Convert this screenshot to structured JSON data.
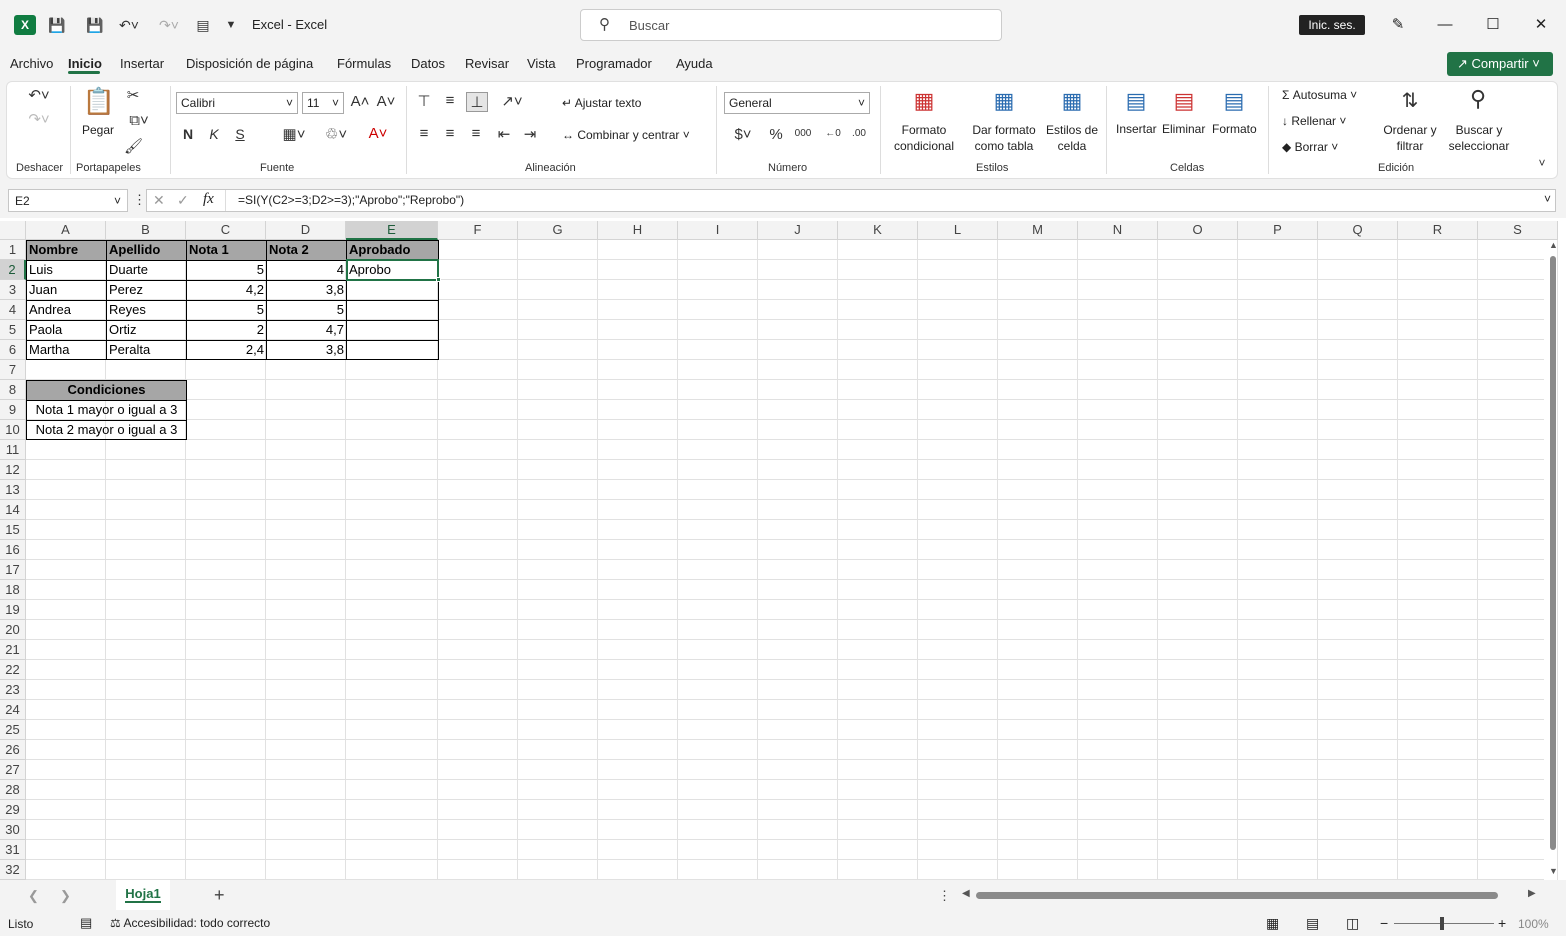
{
  "app": {
    "title": "Excel  -  Excel",
    "search_placeholder": "Buscar",
    "signin": "Inic. ses.",
    "share": "Compartir"
  },
  "menu": [
    "Archivo",
    "Inicio",
    "Insertar",
    "Disposición de página",
    "Fórmulas",
    "Datos",
    "Revisar",
    "Vista",
    "Programador",
    "Ayuda"
  ],
  "ribbon": {
    "groups": [
      "Deshacer",
      "Portapapeles",
      "Fuente",
      "Alineación",
      "Número",
      "Estilos",
      "Celdas",
      "Edición"
    ],
    "paste": "Pegar",
    "font_name": "Calibri",
    "font_size": "11",
    "bold": "N",
    "italic": "K",
    "underline": "S",
    "wrap_text": "Ajustar texto",
    "merge_center": "Combinar y centrar",
    "number_format": "General",
    "cond_format": [
      "Formato",
      "condicional"
    ],
    "format_table": [
      "Dar formato",
      "como tabla"
    ],
    "cell_styles": [
      "Estilos de",
      "celda"
    ],
    "insert": "Insertar",
    "delete": "Eliminar",
    "format": "Formato",
    "autosum": "Autosuma",
    "fill": "Rellenar",
    "clear": "Borrar",
    "sort_filter": [
      "Ordenar y",
      "filtrar"
    ],
    "find_select": [
      "Buscar y",
      "seleccionar"
    ]
  },
  "formula_bar": {
    "name_box": "E2",
    "formula": "=SI(Y(C2>=3;D2>=3);\"Aprobo\";\"Reprobo\")"
  },
  "columns": [
    "A",
    "B",
    "C",
    "D",
    "E",
    "F",
    "G",
    "H",
    "I",
    "J",
    "K",
    "L",
    "M",
    "N",
    "O",
    "P",
    "Q",
    "R",
    "S"
  ],
  "rows": [
    "1",
    "2",
    "3",
    "4",
    "5",
    "6",
    "7",
    "8",
    "9",
    "10",
    "11",
    "12",
    "13",
    "14",
    "15",
    "16",
    "17",
    "18",
    "19",
    "20",
    "21",
    "22",
    "23",
    "24",
    "25",
    "26",
    "27",
    "28",
    "29",
    "30",
    "31",
    "32"
  ],
  "table": {
    "headers": [
      "Nombre",
      "Apellido",
      "Nota 1",
      "Nota 2",
      "Aprobado"
    ],
    "rows": [
      [
        "Luis",
        "Duarte",
        "5",
        "4",
        "Aprobo"
      ],
      [
        "Juan",
        "Perez",
        "4,2",
        "3,8",
        ""
      ],
      [
        "Andrea",
        "Reyes",
        "5",
        "5",
        ""
      ],
      [
        "Paola",
        "Ortiz",
        "2",
        "4,7",
        ""
      ],
      [
        "Martha",
        "Peralta",
        "2,4",
        "3,8",
        ""
      ]
    ]
  },
  "conditions": {
    "header": "Condiciones",
    "items": [
      "Nota 1 mayor o igual a 3",
      "Nota 2 mayor o igual a 3"
    ]
  },
  "sheet_tab": "Hoja1",
  "status": {
    "ready": "Listo",
    "accessibility": "Accesibilidad: todo correcto",
    "zoom": "100%"
  }
}
